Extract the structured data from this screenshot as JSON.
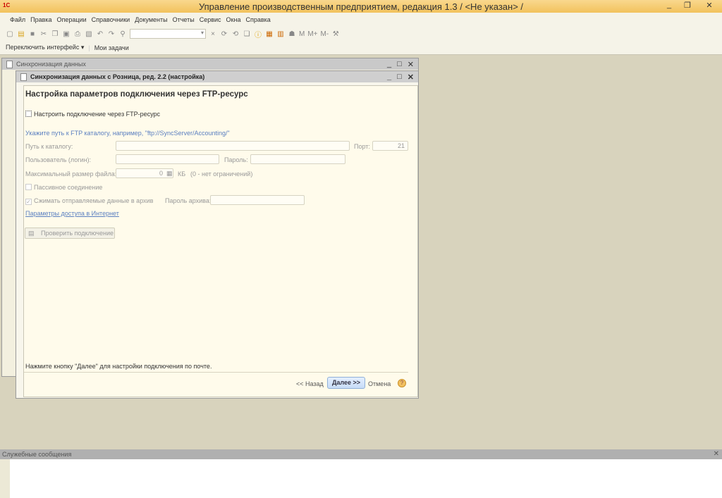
{
  "window": {
    "title": "Управление производственным предприятием, редакция 1.3 / <Не указан> /",
    "logo": "1С",
    "minimize": "_",
    "restore": "❐",
    "close": "✕"
  },
  "menu": [
    "Файл",
    "Правка",
    "Операции",
    "Справочники",
    "Документы",
    "Отчеты",
    "Сервис",
    "Окна",
    "Справка"
  ],
  "toolbar": {
    "icons": [
      "new-icon",
      "open-icon",
      "save-icon",
      "cut-icon",
      "copy-icon",
      "paste-icon",
      "print-icon",
      "preview-icon",
      "undo-icon",
      "redo-icon",
      "search-icon"
    ],
    "search_value": "",
    "m": "M",
    "mplus": "M+",
    "mminus": "M-"
  },
  "toolbar2": {
    "switch": "Переключить интерфейс ▾",
    "tasks": "Мои задачи"
  },
  "outer_window": {
    "title": "Синхронизация данных"
  },
  "dialog": {
    "title": "Синхронизация данных с Розница, ред. 2.2 (настройка)",
    "heading": "Настройка параметров подключения через FTP-ресурс",
    "ftp_checkbox": "Настроить подключение через FTP-ресурс",
    "hint": "Укажите путь к FTP каталогу, например, \"ftp://SyncServer/Accounting/\"",
    "path_label": "Путь к каталогу:",
    "path_value": "",
    "port_label": "Порт:",
    "port_value": "21",
    "user_label": "Пользователь (логин):",
    "user_value": "",
    "password_label": "Пароль:",
    "password_value": "",
    "maxsize_label": "Максимальный размер файла:",
    "maxsize_value": "0",
    "maxsize_unit": "КБ",
    "maxsize_note": "(0 - нет ограничений)",
    "passive_label": "Пассивное соединение",
    "passive_checked": false,
    "compress_label": "Сжимать отправляемые данные в архив",
    "compress_checked": true,
    "archive_password_label": "Пароль архива:",
    "internet_link": "Параметры доступа в Интернет",
    "check_button": "Проверить подключение",
    "footer_note": "Нажмите кнопку \"Далее\" для настройки подключения по почте.",
    "back": "<< Назад",
    "next": "Далее >>",
    "cancel": "Отмена",
    "help": "?"
  },
  "messages": {
    "title": "Служебные сообщения"
  }
}
